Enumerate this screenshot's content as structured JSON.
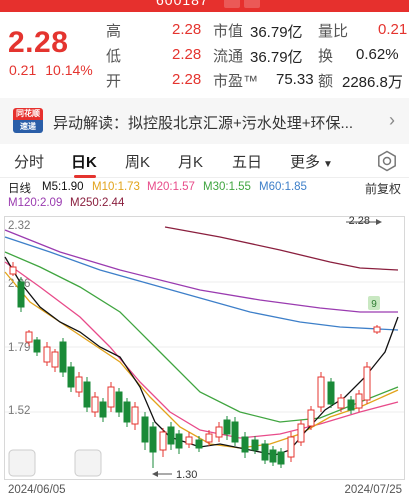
{
  "header": {
    "code_partial": "600187"
  },
  "quote": {
    "price": "2.28",
    "change": "0.21",
    "change_pct": "10.14%",
    "high_label": "高",
    "high": "2.28",
    "low_label": "低",
    "low": "2.28",
    "open_label": "开",
    "open": "2.28",
    "mktcap_label": "市值",
    "mktcap": "36.79亿",
    "float_label": "流通",
    "float": "36.79亿",
    "pe_label": "市盈™",
    "pe": "75.33",
    "vr_label": "量比",
    "vr": "0.21",
    "turnover_label": "换",
    "turnover": "0.62%",
    "amount_label": "额",
    "amount": "2286.8万"
  },
  "news": {
    "logo_top": "同花顺",
    "logo_bottom": "速递",
    "text": "异动解读：拟控股北京汇源+污水处理+环保..."
  },
  "tabs": [
    {
      "label": "分时"
    },
    {
      "label": "日K"
    },
    {
      "label": "周K"
    },
    {
      "label": "月K"
    },
    {
      "label": "五日"
    },
    {
      "label": "更多"
    }
  ],
  "ma": {
    "line_label": "日线",
    "m5": "M5:1.90",
    "m10": "M10:1.73",
    "m20": "M20:1.57",
    "m30": "M30:1.55",
    "m60": "M60:1.85",
    "m120": "M120:2.09",
    "m250": "M250:2.44",
    "fuquan": "前复权"
  },
  "colors": {
    "up": "#e4342f",
    "down": "#1a8a38",
    "m5": "#111111",
    "m10": "#e2a31b",
    "m20": "#e84b8a",
    "m30": "#40a540",
    "m60": "#3d7fc9",
    "m120": "#9a3bb0",
    "m250": "#8a1f3e"
  },
  "chart_labels": {
    "y_top": "2.32",
    "y_mid_high": "2.06",
    "y_mid_low": "1.79",
    "y_low": "1.52",
    "max_label": "2.28",
    "min_label": "1.30",
    "start_date": "2024/06/05",
    "end_date": "2024/07/25",
    "badge_9": "9"
  }
}
